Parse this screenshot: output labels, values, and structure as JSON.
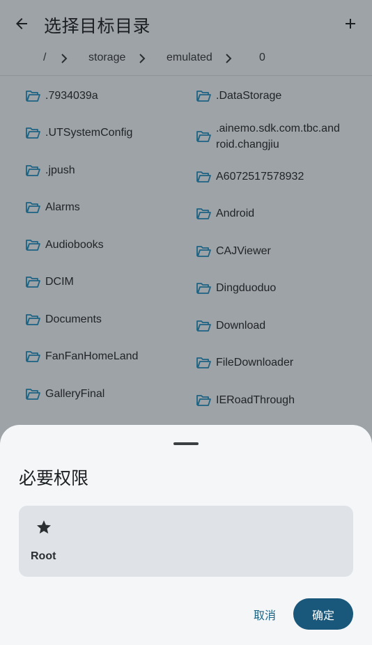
{
  "header": {
    "title": "选择目标目录",
    "back_icon": "arrow-back-icon",
    "add_icon": "add-icon"
  },
  "breadcrumb": [
    "/",
    "storage",
    "emulated",
    "0"
  ],
  "folders": {
    "left": [
      ".7934039a",
      ".UTSystemConfig",
      ".jpush",
      "Alarms",
      "Audiobooks",
      "DCIM",
      "Documents",
      "FanFanHomeLand",
      "GalleryFinal"
    ],
    "right": [
      ".DataStorage",
      ".ainemo.sdk.com.tbc.and\nroid.changjiu",
      "A6072517578932",
      "Android",
      "CAJViewer",
      "Dingduoduo",
      "Download",
      "FileDownloader",
      "IERoadThrough"
    ]
  },
  "sheet": {
    "title": "必要权限",
    "permission": {
      "icon": "star-icon",
      "label": "Root"
    },
    "cancel_label": "取消",
    "ok_label": "确定"
  },
  "colors": {
    "scrim": "#9ea3a7",
    "sheet_bg": "#f4f6f8",
    "card_bg": "#dfe3e7",
    "primary": "#19587a"
  }
}
